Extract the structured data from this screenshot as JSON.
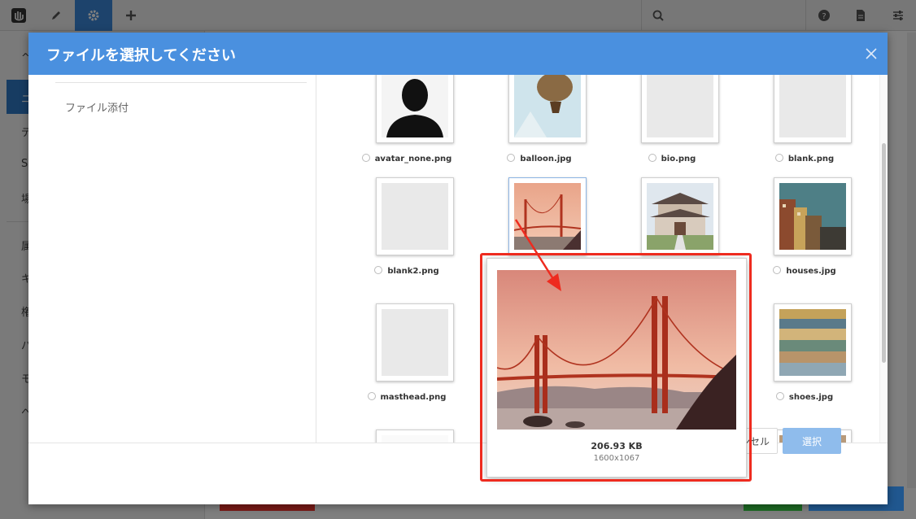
{
  "colors": {
    "accent": "#4a90df",
    "annotation": "#ee2b1f",
    "select_button": "#8fbcec"
  },
  "toolbar": {
    "icons": [
      "logo-icon",
      "pencil-icon",
      "gear-icon",
      "plus-icon",
      "search-icon",
      "help-icon",
      "document-icon",
      "sliders-icon"
    ]
  },
  "sidebar": {
    "letters": [
      "ニ",
      "デ",
      "S",
      "場",
      "属",
      "キ",
      "権",
      "パ",
      "モ",
      "ヘ"
    ]
  },
  "modal": {
    "title": "ファイルを選択してください",
    "left_item": "ファイル添付",
    "files": [
      {
        "name": "avatar_none.png",
        "type": "avatar"
      },
      {
        "name": "balloon.jpg",
        "type": "balloon"
      },
      {
        "name": "bio.png",
        "type": "blank"
      },
      {
        "name": "blank.png",
        "type": "blank"
      },
      {
        "name": "blank2.png",
        "type": "blank"
      },
      {
        "name": "",
        "type": "bridge"
      },
      {
        "name": "",
        "type": "temple"
      },
      {
        "name": "houses.jpg",
        "type": "houses"
      },
      {
        "name": "masthead.png",
        "type": "blank"
      },
      {
        "name": "",
        "type": "hidden"
      },
      {
        "name": "",
        "type": "hidden"
      },
      {
        "name": "shoes.jpg",
        "type": "shoes"
      }
    ],
    "cancel_label": "キャンセル",
    "select_label": "選択"
  },
  "preview": {
    "size": "206.93 KB",
    "dimensions": "1600x1067"
  }
}
